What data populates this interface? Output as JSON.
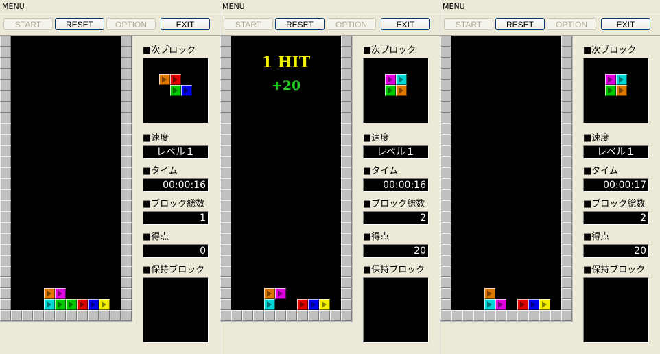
{
  "colors": {
    "orange": "#e07800",
    "magenta": "#e000e0",
    "cyan": "#00d8d8",
    "green": "#00c800",
    "red": "#e00000",
    "blue": "#0000f0",
    "yellow": "#f0f000"
  },
  "panels": [
    {
      "menu": "MENU",
      "buttons": {
        "start": "START",
        "reset": "RESET",
        "option": "OPTION",
        "exit": "EXIT"
      },
      "labels": {
        "next": "■次ブロック",
        "speed": "■速度",
        "time": "■タイム",
        "count": "■ブロック総数",
        "score": "■得点",
        "hold": "■保持ブロック"
      },
      "speed": "レベル１",
      "time": "00:00:16",
      "count": "1",
      "score": "0",
      "hit": "",
      "bonus": "",
      "next_piece": [
        {
          "col": 0,
          "row": 0,
          "color": "orange"
        },
        {
          "col": 1,
          "row": 0,
          "color": "red"
        },
        {
          "col": 1,
          "row": 1,
          "color": "green"
        },
        {
          "col": 2,
          "row": 1,
          "color": "blue"
        }
      ],
      "board_cells": [
        {
          "col": 3,
          "row": 23,
          "color": "orange"
        },
        {
          "col": 4,
          "row": 23,
          "color": "magenta"
        },
        {
          "col": 3,
          "row": 24,
          "color": "cyan"
        },
        {
          "col": 4,
          "row": 24,
          "color": "green"
        },
        {
          "col": 5,
          "row": 24,
          "color": "green"
        },
        {
          "col": 6,
          "row": 24,
          "color": "red"
        },
        {
          "col": 7,
          "row": 24,
          "color": "blue"
        },
        {
          "col": 8,
          "row": 24,
          "color": "yellow"
        }
      ]
    },
    {
      "menu": "MENU",
      "buttons": {
        "start": "START",
        "reset": "RESET",
        "option": "OPTION",
        "exit": "EXIT"
      },
      "labels": {
        "next": "■次ブロック",
        "speed": "■速度",
        "time": "■タイム",
        "count": "■ブロック総数",
        "score": "■得点",
        "hold": "■保持ブロック"
      },
      "speed": "レベル１",
      "time": "00:00:16",
      "count": "2",
      "score": "20",
      "hit": "1 HIT",
      "bonus": "+20",
      "next_piece": [
        {
          "col": 0,
          "row": 0,
          "color": "magenta"
        },
        {
          "col": 1,
          "row": 0,
          "color": "cyan"
        },
        {
          "col": 0,
          "row": 1,
          "color": "green"
        },
        {
          "col": 1,
          "row": 1,
          "color": "orange"
        }
      ],
      "board_cells": [
        {
          "col": 3,
          "row": 23,
          "color": "orange"
        },
        {
          "col": 4,
          "row": 23,
          "color": "magenta"
        },
        {
          "col": 3,
          "row": 24,
          "color": "cyan"
        },
        {
          "col": 6,
          "row": 24,
          "color": "red"
        },
        {
          "col": 7,
          "row": 24,
          "color": "blue"
        },
        {
          "col": 8,
          "row": 24,
          "color": "yellow"
        }
      ]
    },
    {
      "menu": "MENU",
      "buttons": {
        "start": "START",
        "reset": "RESET",
        "option": "OPTION",
        "exit": "EXIT"
      },
      "labels": {
        "next": "■次ブロック",
        "speed": "■速度",
        "time": "■タイム",
        "count": "■ブロック総数",
        "score": "■得点",
        "hold": "■保持ブロック"
      },
      "speed": "レベル１",
      "time": "00:00:17",
      "count": "2",
      "score": "20",
      "hit": "",
      "bonus": "",
      "next_piece": [
        {
          "col": 0,
          "row": 0,
          "color": "magenta"
        },
        {
          "col": 1,
          "row": 0,
          "color": "cyan"
        },
        {
          "col": 0,
          "row": 1,
          "color": "green"
        },
        {
          "col": 1,
          "row": 1,
          "color": "orange"
        }
      ],
      "board_cells": [
        {
          "col": 3,
          "row": 23,
          "color": "orange"
        },
        {
          "col": 3,
          "row": 24,
          "color": "cyan"
        },
        {
          "col": 4,
          "row": 24,
          "color": "magenta"
        },
        {
          "col": 6,
          "row": 24,
          "color": "red"
        },
        {
          "col": 7,
          "row": 24,
          "color": "blue"
        },
        {
          "col": 8,
          "row": 24,
          "color": "yellow"
        }
      ]
    }
  ]
}
